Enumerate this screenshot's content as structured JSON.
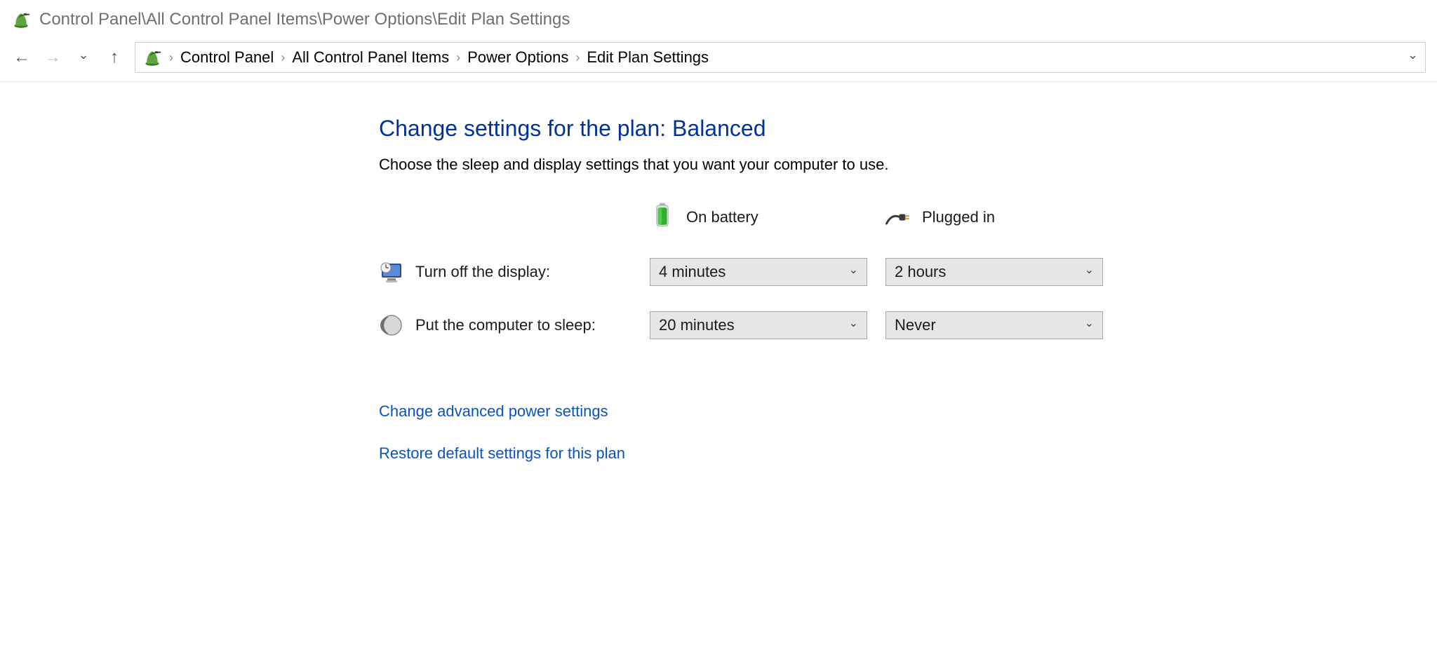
{
  "window": {
    "title_path": "Control Panel\\All Control Panel Items\\Power Options\\Edit Plan Settings"
  },
  "breadcrumb": {
    "items": [
      "Control Panel",
      "All Control Panel Items",
      "Power Options",
      "Edit Plan Settings"
    ]
  },
  "page": {
    "heading": "Change settings for the plan: Balanced",
    "subtext": "Choose the sleep and display settings that you want your computer to use.",
    "columns": {
      "battery_label": "On battery",
      "plugged_label": "Plugged in"
    },
    "rows": {
      "display": {
        "label": "Turn off the display:",
        "battery_value": "4 minutes",
        "plugged_value": "2 hours"
      },
      "sleep": {
        "label": "Put the computer to sleep:",
        "battery_value": "20 minutes",
        "plugged_value": "Never"
      }
    },
    "links": {
      "advanced": "Change advanced power settings",
      "restore": "Restore default settings for this plan"
    }
  }
}
